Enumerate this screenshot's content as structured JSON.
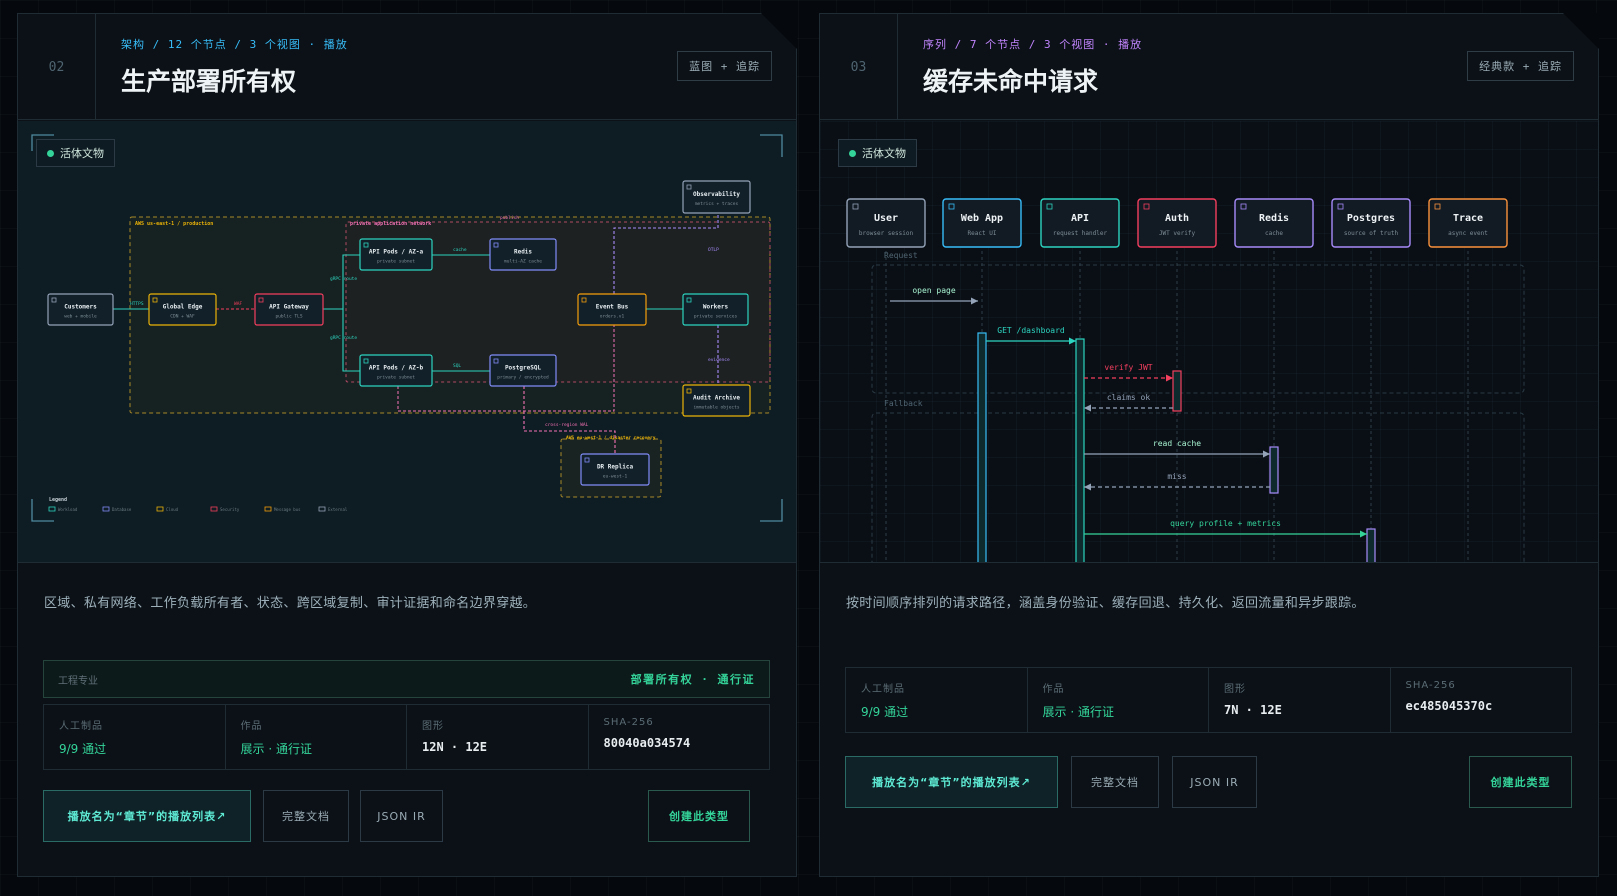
{
  "cards": [
    {
      "num": "02",
      "meta": "架构 / 12 个节点 / 3 个视图 · 播放",
      "meta_color": "#38bdf8",
      "title": "生产部署所有权",
      "tag": "蓝图 + 追踪",
      "live": "活体文物",
      "desc": "区域、私有网络、工作负载所有者、状态、跨区域复制、审计证据和命名边界穿越。",
      "pro_label": "工程专业",
      "pro_value": "部署所有权 · 通行证",
      "stats": [
        {
          "k": "人工制品",
          "v": "9/9 通过"
        },
        {
          "k": "作品",
          "v": "展示 · 通行证"
        },
        {
          "k": "图形",
          "v": "12N · 12E"
        },
        {
          "k": "SHA-256",
          "v": "80040a034574"
        }
      ],
      "buttons": {
        "primary": "播放名为“章节”的播放列表↗",
        "doc": "完整文档",
        "json": "JSON IR",
        "create": "创建此类型"
      },
      "diagram": {
        "nodes": [
          {
            "t": "Customers",
            "s": "web + mobile",
            "c": "#94a3b8"
          },
          {
            "t": "Global Edge",
            "s": "CDN + WAF",
            "c": "#eab308"
          },
          {
            "t": "API Gateway",
            "s": "public TLS",
            "c": "#f43f5e"
          },
          {
            "t": "API Pods / AZ-a",
            "s": "private subnet",
            "c": "#2dd4bf"
          },
          {
            "t": "Redis",
            "s": "multi-AZ cache",
            "c": "#818cf8"
          },
          {
            "t": "API Pods / AZ-b",
            "s": "private subnet",
            "c": "#2dd4bf"
          },
          {
            "t": "PostgreSQL",
            "s": "primary / encrypted",
            "c": "#818cf8"
          },
          {
            "t": "Event Bus",
            "s": "orders.v1",
            "c": "#f59e0b"
          },
          {
            "t": "Workers",
            "s": "private services",
            "c": "#2dd4bf"
          },
          {
            "t": "Observability",
            "s": "metrics + traces",
            "c": "#94a3b8"
          },
          {
            "t": "Audit Archive",
            "s": "immutable objects",
            "c": "#eab308"
          },
          {
            "t": "DR Replica",
            "s": "eu-west-1",
            "c": "#818cf8"
          }
        ],
        "regions": [
          "AWS us-east-1 / production",
          "private application network",
          "AWS eu-west-1 / disaster recovery"
        ],
        "edges": [
          "HTTPS",
          "WAF",
          "gRPC route",
          "gRPC route",
          "cache",
          "SQL",
          "publish",
          "OTLP",
          "evidence",
          "cross-region WAL"
        ],
        "legend_title": "Legend",
        "legend": [
          "Workload",
          "Database",
          "Cloud",
          "Security",
          "Message bus",
          "External"
        ]
      }
    },
    {
      "num": "03",
      "meta": "序列 / 7 个节点 / 3 个视图 · 播放",
      "meta_color": "#c084fc",
      "title": "缓存未命中请求",
      "tag": "经典款 + 追踪",
      "live": "活体文物",
      "desc": "按时间顺序排列的请求路径，涵盖身份验证、缓存回退、持久化、返回流量和异步跟踪。",
      "stats": [
        {
          "k": "人工制品",
          "v": "9/9 通过"
        },
        {
          "k": "作品",
          "v": "展示 · 通行证"
        },
        {
          "k": "图形",
          "v": "7N · 12E"
        },
        {
          "k": "SHA-256",
          "v": "ec485045370c"
        }
      ],
      "buttons": {
        "primary": "播放名为“章节”的播放列表↗",
        "doc": "完整文档",
        "json": "JSON IR",
        "create": "创建此类型"
      },
      "sequence": {
        "actors": [
          {
            "t": "User",
            "s": "browser session",
            "c": "#94a3b8"
          },
          {
            "t": "Web App",
            "s": "React UI",
            "c": "#38bdf8"
          },
          {
            "t": "API",
            "s": "request handler",
            "c": "#2dd4bf"
          },
          {
            "t": "Auth",
            "s": "JWT verify",
            "c": "#f43f5e"
          },
          {
            "t": "Redis",
            "s": "cache",
            "c": "#a78bfa"
          },
          {
            "t": "Postgres",
            "s": "source of truth",
            "c": "#a78bfa"
          },
          {
            "t": "Trace",
            "s": "async event",
            "c": "#fb923c"
          }
        ],
        "groups": [
          "Request",
          "Fallback"
        ],
        "messages": [
          "open page",
          "GET /dashboard",
          "verify JWT",
          "claims ok",
          "read cache",
          "miss",
          "query profile + metrics"
        ]
      }
    }
  ],
  "colors": {
    "accent": "#34d399",
    "teal": "#5eead4"
  }
}
